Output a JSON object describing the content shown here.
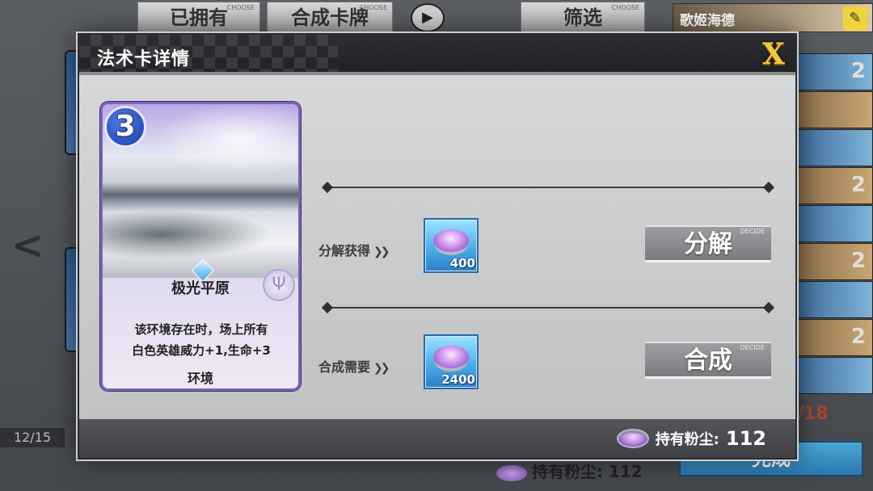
{
  "background": {
    "tabs": [
      {
        "label": "已拥有",
        "sub": "CHOOSE"
      },
      {
        "label": "合成卡牌",
        "sub": "CHOOSE"
      },
      {
        "label": "筛选",
        "sub": "CHOOSE"
      }
    ],
    "play_label": "▶",
    "hero_name": "歌姬海德",
    "list_counts": [
      "2",
      "",
      "",
      "2",
      "",
      "2",
      "",
      "2",
      ""
    ],
    "deck_count": "12/15",
    "right_count": "/18",
    "dust_label": "持有粉尘:",
    "dust_value": "112",
    "done_label": "完成"
  },
  "modal": {
    "title": "法术卡详情",
    "close_label": "X",
    "card": {
      "cost": "3",
      "name": "极光平原",
      "description_line1": "该环境存在时，场上所有",
      "description_line2": "白色英雄威力+1,生命+3",
      "type": "环境",
      "emblem_icon": "trident-icon"
    },
    "disenchant": {
      "label": "分解获得",
      "amount": "400",
      "button_label": "分解",
      "button_sub": "DECIDE"
    },
    "craft": {
      "label": "合成需要",
      "amount": "2400",
      "button_label": "合成",
      "button_sub": "DECIDE"
    },
    "footer": {
      "dust_label": "持有粉尘:",
      "dust_value": "112"
    }
  }
}
